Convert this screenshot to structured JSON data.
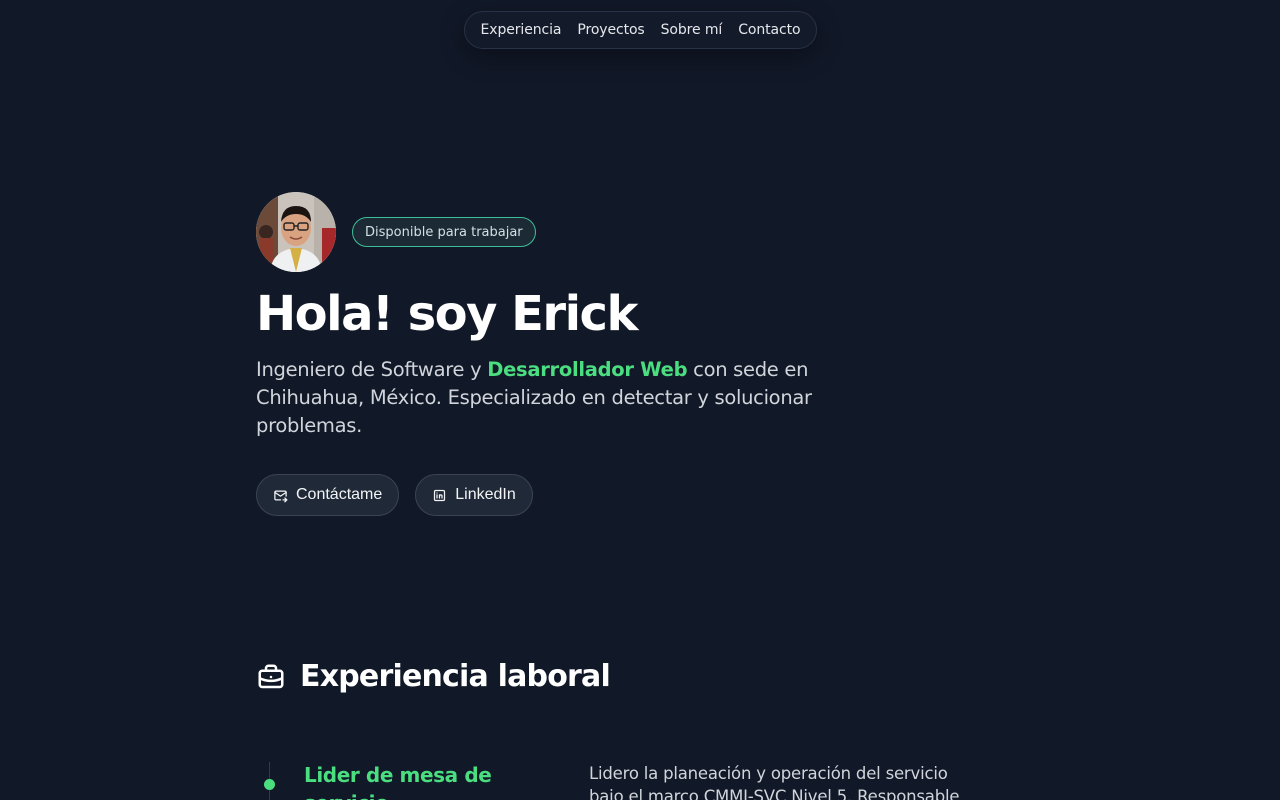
{
  "nav": {
    "items": [
      "Experiencia",
      "Proyectos",
      "Sobre mí",
      "Contacto"
    ]
  },
  "hero": {
    "badge": "Disponible para trabajar",
    "title": "Hola! soy Erick",
    "lead_before": "Ingeniero de Software y ",
    "lead_highlight": "Desarrollador Web",
    "lead_after": " con sede en Chihuahua, México. Especializado en detectar y solucionar problemas.",
    "buttons": {
      "contact": {
        "label": "Contáctame",
        "icon": "mail-icon"
      },
      "linkedin": {
        "label": "LinkedIn",
        "icon": "linkedin-icon"
      }
    }
  },
  "experience": {
    "title": "Experiencia laboral",
    "icon": "briefcase-icon",
    "jobs": [
      {
        "title": "Lider de mesa de servicio",
        "description": "Lidero la planeación y operación del servicio bajo el marco CMMI-SVC Nivel 5. Responsable de la"
      }
    ]
  },
  "colors": {
    "background": "#111827",
    "accent": "#4ade80",
    "badge_border": "#3fbf99"
  }
}
